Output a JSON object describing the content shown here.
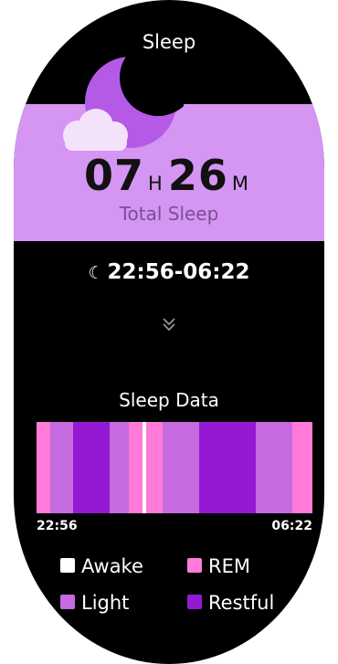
{
  "header": {
    "title": "Sleep"
  },
  "summary": {
    "hours": "07",
    "hours_unit": "H",
    "minutes": "26",
    "minutes_unit": "M",
    "caption": "Total Sleep"
  },
  "schedule": {
    "range": "22:56-06:22",
    "icon": "moon-icon"
  },
  "expand": {
    "icon": "double-chevron-down-icon"
  },
  "sleep_data": {
    "title": "Sleep Data",
    "start_time": "22:56",
    "end_time": "06:22",
    "colors": {
      "Awake": "#ffffff",
      "REM": "#ff7ad9",
      "Light": "#c56bdf",
      "Restful": "#9419d3"
    },
    "stages": [
      {
        "stage": "REM",
        "fraction": 0.049
      },
      {
        "stage": "Light",
        "fraction": 0.083
      },
      {
        "stage": "Restful",
        "fraction": 0.132
      },
      {
        "stage": "Light",
        "fraction": 0.069
      },
      {
        "stage": "REM",
        "fraction": 0.049
      },
      {
        "stage": "Awake",
        "fraction": 0.014
      },
      {
        "stage": "REM",
        "fraction": 0.059
      },
      {
        "stage": "Light",
        "fraction": 0.132
      },
      {
        "stage": "Restful",
        "fraction": 0.205
      },
      {
        "stage": "Light",
        "fraction": 0.132
      },
      {
        "stage": "REM",
        "fraction": 0.076
      }
    ],
    "legend": [
      {
        "label": "Awake",
        "color": "#ffffff"
      },
      {
        "label": "REM",
        "color": "#ff7ad9"
      },
      {
        "label": "Light",
        "color": "#c56bdf"
      },
      {
        "label": "Restful",
        "color": "#9419d3"
      }
    ]
  },
  "theme": {
    "accent": "#d595f3",
    "moon": "#b45ae6",
    "cloud": "#f4e2fb"
  }
}
